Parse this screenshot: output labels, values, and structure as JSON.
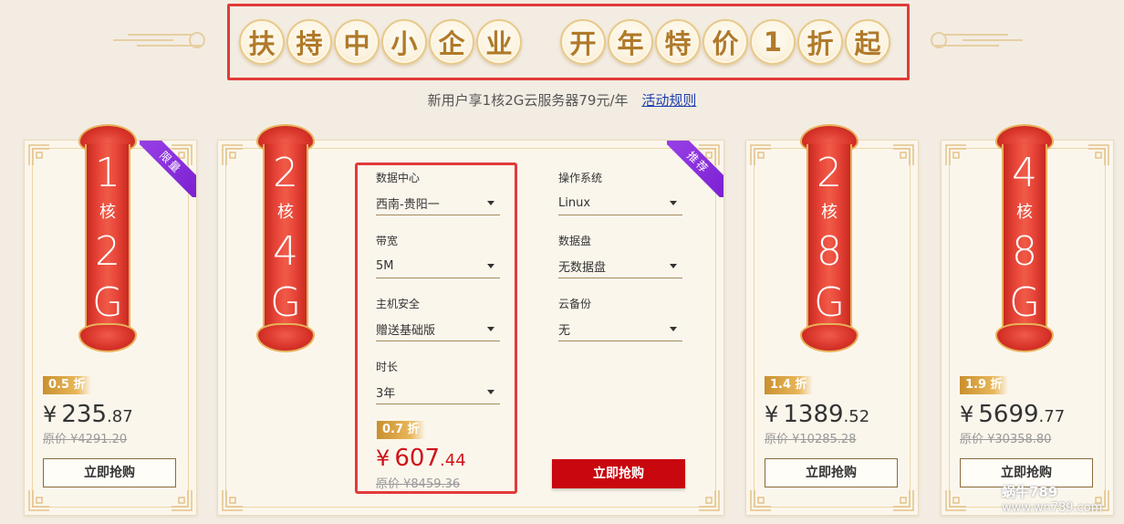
{
  "banner": {
    "chars_left": [
      "扶",
      "持",
      "中",
      "小",
      "企",
      "业"
    ],
    "chars_right": [
      "开",
      "年",
      "特",
      "价",
      "1",
      "折",
      "起"
    ]
  },
  "subline": {
    "text": "新用户享1核2G云服务器79元/年",
    "link": "活动规则"
  },
  "cards": [
    {
      "cpu": "1",
      "core_label": "核",
      "mem": "2",
      "mem_unit": "G",
      "tag": "限量",
      "discount": "0.5 折",
      "price_symbol": "¥",
      "price_int": "235",
      "price_dec": ".87",
      "original": "原价 ¥4291.20",
      "buy": "立即抢购"
    },
    {
      "cpu": "2",
      "core_label": "核",
      "mem": "4",
      "mem_unit": "G",
      "tag": "推荐",
      "discount": "0.7 折",
      "price_symbol": "¥",
      "price_int": "607",
      "price_dec": ".44",
      "original": "原价 ¥8459.36",
      "buy": "立即抢购",
      "config": {
        "datacenter_label": "数据中心",
        "datacenter": "西南-贵阳一",
        "os_label": "操作系统",
        "os": "Linux",
        "bandwidth_label": "带宽",
        "bandwidth": "5M",
        "disk_label": "数据盘",
        "disk": "无数据盘",
        "security_label": "主机安全",
        "security": "赠送基础版",
        "backup_label": "云备份",
        "backup": "无",
        "duration_label": "时长",
        "duration": "3年"
      }
    },
    {
      "cpu": "2",
      "core_label": "核",
      "mem": "8",
      "mem_unit": "G",
      "discount": "1.4 折",
      "price_symbol": "¥",
      "price_int": "1389",
      "price_dec": ".52",
      "original": "原价 ¥10285.28",
      "buy": "立即抢购"
    },
    {
      "cpu": "4",
      "core_label": "核",
      "mem": "8",
      "mem_unit": "G",
      "discount": "1.9 折",
      "price_symbol": "¥",
      "price_int": "5699",
      "price_dec": ".77",
      "original": "原价 ¥30358.80",
      "buy": "立即抢购"
    }
  ],
  "watermark": {
    "title": "蜗牛789",
    "url": "www.wn789.com"
  },
  "colors": {
    "accent_red": "#c8070f",
    "gold": "#b07a2a",
    "bg": "#f3ece2",
    "tag_purple": "#8a30de"
  }
}
